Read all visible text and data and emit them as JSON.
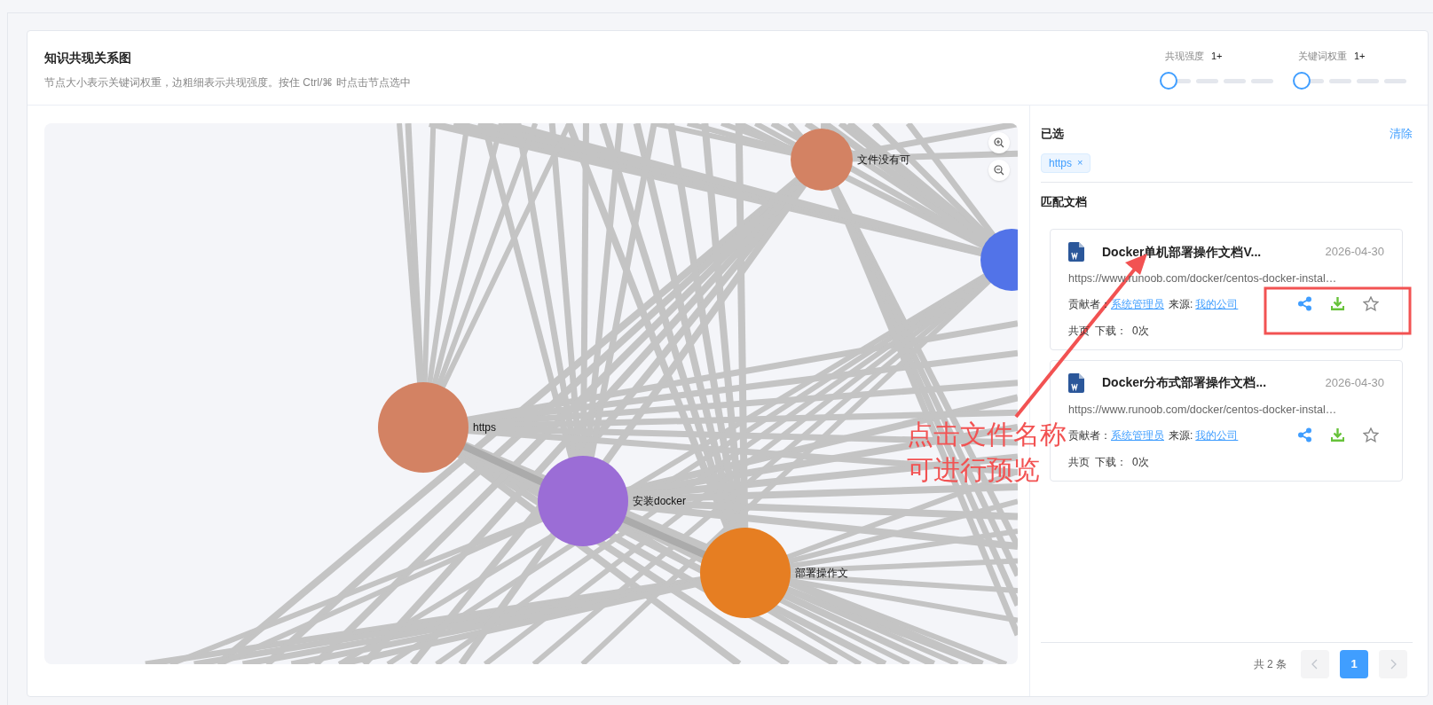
{
  "header": {
    "title": "知识共现关系图",
    "subtitle": "节点大小表示关键词权重，边粗细表示共现强度。按住 Ctrl/⌘ 时点击节点选中"
  },
  "sliders": [
    {
      "label": "共现强度",
      "value": "1+",
      "level": 0
    },
    {
      "label": "关键词权重",
      "value": "1+",
      "level": 0
    }
  ],
  "graph": {
    "nodes": [
      {
        "label": "文件没有可",
        "color": "#d38263"
      },
      {
        "color": "#5273e8"
      },
      {
        "label": "https",
        "color": "#d38263"
      },
      {
        "label": "安装docker",
        "color": "#9b6dd6"
      },
      {
        "label": "部署操作文",
        "color": "#e67e22"
      }
    ]
  },
  "selected": {
    "title": "已选",
    "clear": "清除",
    "tags": [
      "https"
    ],
    "remove": "×"
  },
  "matches": {
    "title": "匹配文档",
    "docs": [
      {
        "title": "Docker单机部署操作文档V...",
        "date": "2026-04-30",
        "url": "https://www.runoob.com/docker/centos-docker-instal…",
        "contributor_label": "贡献者：",
        "contributor": "系统管理员",
        "source_label": "来源:",
        "source": "我的公司",
        "pages": "共页",
        "downloads_label": "下载：",
        "downloads": "0次"
      },
      {
        "title": "Docker分布式部署操作文档...",
        "date": "2026-04-30",
        "url": "https://www.runoob.com/docker/centos-docker-instal…",
        "contributor_label": "贡献者：",
        "contributor": "系统管理员",
        "source_label": "来源:",
        "source": "我的公司",
        "pages": "共页",
        "downloads_label": "下载：",
        "downloads": "0次"
      }
    ]
  },
  "pagination": {
    "total": "共 2 条",
    "pages": [
      {
        "label": "1",
        "selected": true
      }
    ]
  },
  "annotation": {
    "lines": [
      "点击文件名称",
      "可进行预览"
    ]
  }
}
